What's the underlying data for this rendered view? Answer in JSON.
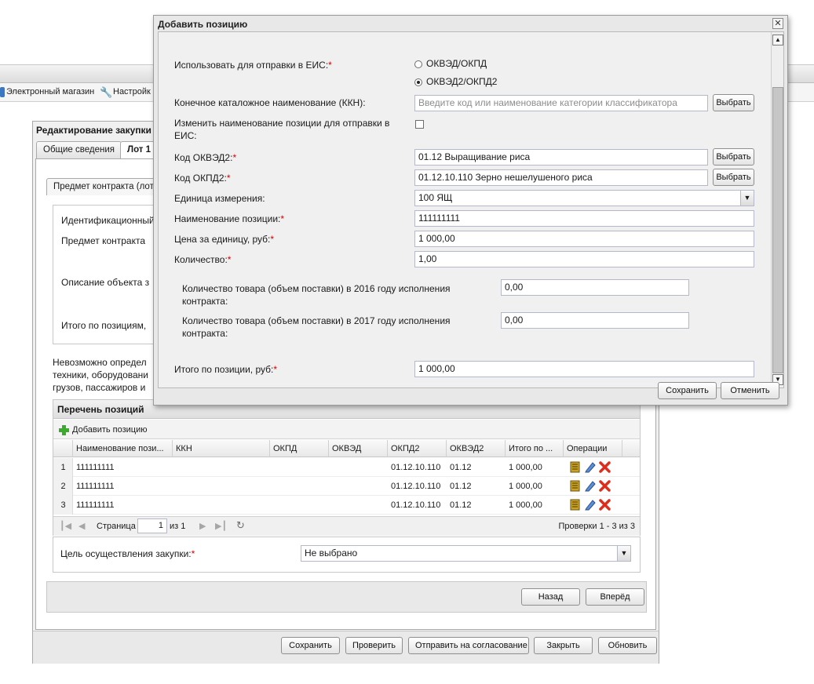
{
  "app": {
    "toolbar": {
      "shop_label": "Электронный магазин",
      "settings_label": "Настройк"
    }
  },
  "editor": {
    "title": "Редактирование закупки",
    "tabs": [
      "Общие сведения",
      "Лот 1"
    ],
    "subtab": "Предмет контракта (лот",
    "fields": {
      "identifier": "Идентификационный",
      "subject": "Предмет контракта",
      "description": "Описание объекта з",
      "total": "Итого по позициям,"
    },
    "note_lines": [
      "Невозможно определ",
      "техники, оборудовани",
      "грузов, пассажиров и"
    ],
    "positions": {
      "title": "Перечень позиций",
      "add_label": "Добавить позицию",
      "columns": [
        "Наименование пози...",
        "ККН",
        "ОКПД",
        "ОКВЭД",
        "ОКПД2",
        "ОКВЭД2",
        "Итого по ...",
        "Операции"
      ],
      "rows": [
        {
          "num": "1",
          "name": "111111111",
          "kkn": "",
          "okpd": "",
          "okved": "",
          "okpd2": "01.12.10.110",
          "okved2": "01.12",
          "total": "1 000,00"
        },
        {
          "num": "2",
          "name": "111111111",
          "kkn": "",
          "okpd": "",
          "okved": "",
          "okpd2": "01.12.10.110",
          "okved2": "01.12",
          "total": "1 000,00"
        },
        {
          "num": "3",
          "name": "111111111",
          "kkn": "",
          "okpd": "",
          "okved": "",
          "okpd2": "01.12.10.110",
          "okved2": "01.12",
          "total": "1 000,00"
        }
      ],
      "pager": {
        "page_label": "Страница",
        "page_value": "1",
        "of_label": "из 1",
        "summary": "Проверки 1 - 3 из 3"
      }
    },
    "purpose_label": "Цель осуществления закупки:",
    "purpose_value": "Не выбрано",
    "nav": {
      "back": "Назад",
      "next": "Вперёд"
    },
    "footer": {
      "save": "Сохранить",
      "check": "Проверить",
      "send": "Отправить на согласование",
      "close": "Закрыть",
      "refresh": "Обновить"
    }
  },
  "modal": {
    "title": "Добавить позицию",
    "use_for_eis_label": "Использовать для отправки в ЕИС:",
    "radio_options": [
      "ОКВЭД/ОКПД",
      "ОКВЭД2/ОКПД2"
    ],
    "radio_selected_index": 1,
    "kkn_label": "Конечное каталожное наименование (ККН):",
    "kkn_placeholder": "Введите код или наименование категории классификатора",
    "change_name_label_1": "Изменить наименование позиции для отправки в",
    "change_name_label_2": "ЕИС:",
    "change_name_checked": false,
    "okved2_label": "Код ОКВЭД2:",
    "okved2_value": "01.12 Выращивание риса",
    "okpd2_label": "Код ОКПД2:",
    "okpd2_value": "01.12.10.110 Зерно нешелушеного риса",
    "unit_label": "Единица измерения:",
    "unit_value": "100 ЯЩ",
    "name_label": "Наименование позиции:",
    "name_value": "111111111",
    "price_label": "Цена за единицу, руб:",
    "price_value": "1 000,00",
    "qty_label": "Количество:",
    "qty_value": "1,00",
    "qty2016_label_1": "Количество товара (объем поставки) в 2016 году исполнения",
    "qty2016_label_2": "контракта:",
    "qty2016_value": "0,00",
    "qty2017_label_1": "Количество товара (объем поставки) в 2017 году исполнения",
    "qty2017_label_2": "контракта:",
    "qty2017_value": "0,00",
    "total_label": "Итого по позиции, руб:",
    "total_value": "1 000,00",
    "select_button": "Выбрать",
    "required_mark": "*",
    "save": "Сохранить",
    "cancel": "Отменить"
  }
}
